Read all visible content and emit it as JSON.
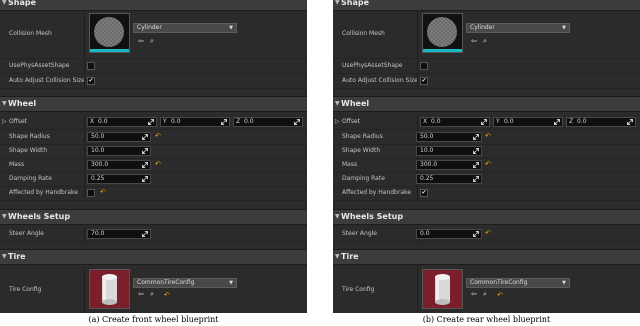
{
  "panels": [
    {
      "sections": {
        "shape": "Shape",
        "wheel": "Wheel",
        "wheels_setup": "Wheels Setup",
        "tire": "Tire"
      },
      "collision_mesh": {
        "label": "Collision Mesh",
        "value": "Cylinder"
      },
      "use_phys_asset_shape": {
        "label": "UsePhysAssetShape",
        "checked": false
      },
      "auto_adjust_collision_size": {
        "label": "Auto Adjust Collision Size",
        "checked": true
      },
      "offset": {
        "label": "Offset",
        "x_axis": "X",
        "x": "0.0",
        "y_axis": "Y",
        "y": "0.0",
        "z_axis": "Z",
        "z": "0.0"
      },
      "shape_radius": {
        "label": "Shape Radius",
        "value": "50.0"
      },
      "shape_width": {
        "label": "Shape Width",
        "value": "10.0"
      },
      "mass": {
        "label": "Mass",
        "value": "300.0"
      },
      "damping_rate": {
        "label": "Damping Rate",
        "value": "0.25"
      },
      "affected_by_handbrake": {
        "label": "Affected by Handbrake",
        "checked": false
      },
      "steer_angle": {
        "label": "Steer Angle",
        "value": "70.0"
      },
      "tire_config": {
        "label": "Tire Config",
        "value": "CommonTireConfig"
      },
      "caption": "(a) Create front wheel blueprint"
    },
    {
      "sections": {
        "shape": "Shape",
        "wheel": "Wheel",
        "wheels_setup": "Wheels Setup",
        "tire": "Tire"
      },
      "collision_mesh": {
        "label": "Collision Mesh",
        "value": "Cylinder"
      },
      "use_phys_asset_shape": {
        "label": "UsePhysAssetShape",
        "checked": false
      },
      "auto_adjust_collision_size": {
        "label": "Auto Adjust Collision Size",
        "checked": true
      },
      "offset": {
        "label": "Offset",
        "x_axis": "X",
        "x": "0.0",
        "y_axis": "Y",
        "y": "0.0",
        "z_axis": "Z",
        "z": "0.0"
      },
      "shape_radius": {
        "label": "Shape Radius",
        "value": "50.0"
      },
      "shape_width": {
        "label": "Shape Width",
        "value": "10.0"
      },
      "mass": {
        "label": "Mass",
        "value": "300.0"
      },
      "damping_rate": {
        "label": "Damping Rate",
        "value": "0.25"
      },
      "affected_by_handbrake": {
        "label": "Affected by Handbrake",
        "checked": true
      },
      "steer_angle": {
        "label": "Steer Angle",
        "value": "0.0"
      },
      "tire_config": {
        "label": "Tire Config",
        "value": "CommonTireConfig"
      },
      "caption": "(b) Create rear wheel blueprint"
    }
  ],
  "icons": {
    "expanded": "triangle-down-icon",
    "collapsed": "triangle-right-icon",
    "browse": "arrow-left-icon",
    "search": "magnifier-icon",
    "reset": "reset-to-default-icon",
    "drag": "drag-arrows-icon",
    "dropdown": "chevron-down-icon",
    "check": "checkmark-icon"
  },
  "colors": {
    "panel_bg": "#2b2b2b",
    "section_bg": "#3c3c3c",
    "accent_cyan": "#19b7c2",
    "reset_yellow": "#e8a800",
    "tire_red": "#7a1f2b"
  }
}
